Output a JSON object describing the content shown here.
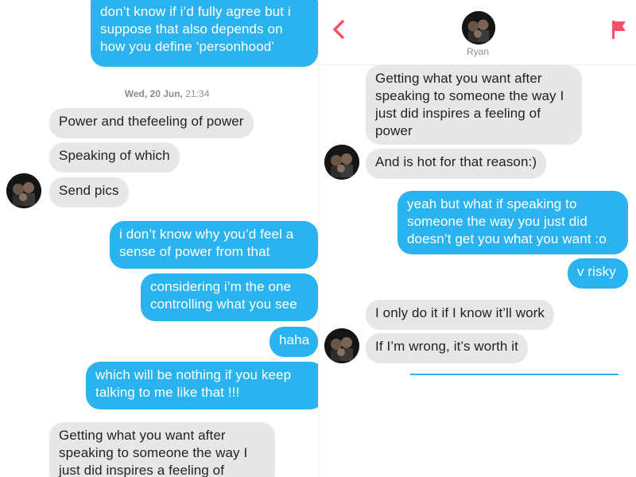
{
  "left": {
    "top_partial_message": "don’t know if i’d fully agree but i\nsuppose that also depends on\nhow you define ‘personhood’",
    "timestamp_day": "Wed, 20 Jun,",
    "timestamp_time": "21:34",
    "messages_in_1": "Power and thefeeling of power",
    "messages_in_2": "Speaking of which",
    "messages_in_3": "Send pics",
    "messages_out_1": "i don’t know why you’d feel a\nsense of power from that",
    "messages_out_2": "considering i’m the one\ncontrolling what you see",
    "messages_out_3": "haha",
    "messages_out_4": "which will be nothing if you keep\ntalking to me like that !!!",
    "bottom_partial_message": "Getting what you want after\nspeaking to someone the way I\njust did inspires a feeling of"
  },
  "right": {
    "header": {
      "name": "Ryan",
      "back_icon": "chevron-left-icon",
      "flag_icon": "flag-icon",
      "accent_color": "#fd5068"
    },
    "messages_in_1": "Getting what you want after\nspeaking to someone the way I\njust did inspires a feeling of\npower",
    "messages_in_2": "And is hot for that reason:)",
    "messages_out_1": "yeah but what if speaking to\nsomeone the way you just did\ndoesn’t get you what you want :o",
    "messages_out_2": "v risky",
    "messages_in_3": "I only do it if I know it’ll work",
    "messages_in_4": "If I’m wrong, it’s worth it"
  },
  "colors": {
    "outgoing_bubble": "#2bb3f0",
    "incoming_bubble": "#e7e7ea"
  }
}
